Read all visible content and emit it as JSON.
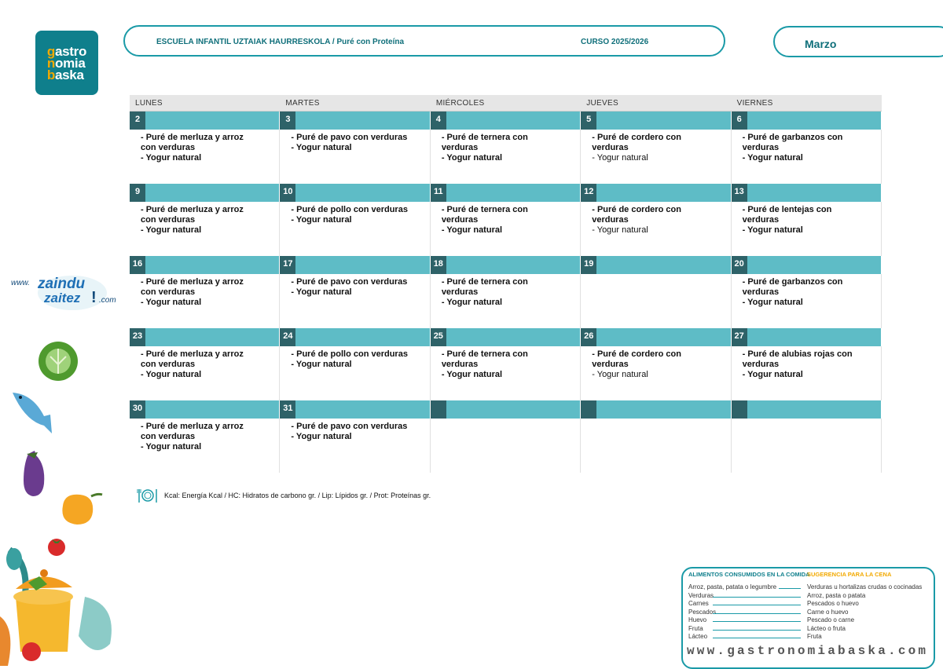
{
  "logo": {
    "line1": "gastro",
    "line2": "nomia",
    "line3": "baska",
    "first_letters": [
      "g",
      "n",
      "b"
    ]
  },
  "header": {
    "title": "ESCUELA INFANTIL UZTAIAK HAURRESKOLA / Puré con Proteína",
    "course": "CURSO 2025/2026"
  },
  "month": "Marzo",
  "calendar": {
    "day_names": [
      "LUNES",
      "MARTES",
      "MIÉRCOLES",
      "JUEVES",
      "VIERNES"
    ],
    "weeks": [
      {
        "days": [
          {
            "num": "2",
            "lines": [
              "- Puré de merluza y arroz",
              "con verduras",
              "- Yogur natural"
            ],
            "normal": []
          },
          {
            "num": "3",
            "lines": [
              "- Puré de pavo con verduras",
              "- Yogur natural"
            ],
            "normal": []
          },
          {
            "num": "4",
            "lines": [
              "- Puré de ternera con",
              "verduras",
              "- Yogur natural"
            ],
            "normal": []
          },
          {
            "num": "5",
            "lines": [
              "- Puré de cordero con",
              "verduras",
              "- Yogur natural"
            ],
            "normal": [
              2
            ]
          },
          {
            "num": "6",
            "lines": [
              "- Puré de garbanzos con",
              "verduras",
              "- Yogur natural"
            ],
            "normal": []
          }
        ]
      },
      {
        "days": [
          {
            "num": "9",
            "lines": [
              "- Puré de merluza y arroz",
              "con verduras",
              "- Yogur natural"
            ],
            "normal": []
          },
          {
            "num": "10",
            "lines": [
              "- Puré de pollo con verduras",
              "- Yogur natural"
            ],
            "normal": []
          },
          {
            "num": "11",
            "lines": [
              "- Puré de ternera con",
              "verduras",
              "- Yogur natural"
            ],
            "normal": []
          },
          {
            "num": "12",
            "lines": [
              "- Puré de cordero con",
              "verduras",
              "- Yogur natural"
            ],
            "normal": [
              2
            ]
          },
          {
            "num": "13",
            "lines": [
              "- Puré de lentejas con",
              "verduras",
              "- Yogur natural"
            ],
            "normal": []
          }
        ]
      },
      {
        "days": [
          {
            "num": "16",
            "lines": [
              "- Puré de merluza y arroz",
              "con verduras",
              "- Yogur natural"
            ],
            "normal": []
          },
          {
            "num": "17",
            "lines": [
              "- Puré de pavo con verduras",
              "- Yogur natural"
            ],
            "normal": []
          },
          {
            "num": "18",
            "lines": [
              "- Puré de ternera con",
              "verduras",
              "- Yogur natural"
            ],
            "normal": []
          },
          {
            "num": "19",
            "lines": [],
            "normal": []
          },
          {
            "num": "20",
            "lines": [
              "- Puré de garbanzos con",
              "verduras",
              "- Yogur natural"
            ],
            "normal": []
          }
        ]
      },
      {
        "days": [
          {
            "num": "23",
            "lines": [
              "- Puré de merluza y arroz",
              "con verduras",
              "- Yogur natural"
            ],
            "normal": []
          },
          {
            "num": "24",
            "lines": [
              "- Puré de pollo con verduras",
              "- Yogur natural"
            ],
            "normal": []
          },
          {
            "num": "25",
            "lines": [
              "- Puré de ternera con",
              "verduras",
              "- Yogur natural"
            ],
            "normal": []
          },
          {
            "num": "26",
            "lines": [
              "- Puré de cordero con",
              "verduras",
              "- Yogur natural"
            ],
            "normal": [
              2
            ]
          },
          {
            "num": "27",
            "lines": [
              "- Puré de alubias rojas con",
              "verduras",
              "- Yogur natural"
            ],
            "normal": []
          }
        ]
      },
      {
        "days": [
          {
            "num": "30",
            "lines": [
              "- Puré de merluza y arroz",
              "con verduras",
              "- Yogur natural"
            ],
            "normal": []
          },
          {
            "num": "31",
            "lines": [
              "- Puré de pavo con verduras",
              "- Yogur natural"
            ],
            "normal": []
          },
          {
            "num": "",
            "lines": [],
            "normal": []
          },
          {
            "num": "",
            "lines": [],
            "normal": []
          },
          {
            "num": "",
            "lines": [],
            "normal": []
          }
        ]
      }
    ]
  },
  "legend": "Kcal: Energía Kcal / HC: Hidratos de carbono gr. / Lip: Lípidos gr. / Prot: Proteínas gr.",
  "side_ad": {
    "prefix": "www.",
    "word1": "zaindu",
    "word2": "zaitez",
    "mark": "!",
    "suffix": ".com"
  },
  "suggestion": {
    "left_title": "ALIMENTOS CONSUMIDOS EN LA COMIDA",
    "right_title": "SUGERENCIA PARA LA CENA",
    "rows": [
      {
        "left": "Arroz, pasta, patata o legumbre",
        "right": "Verduras u hortalizas crudas o cocinadas"
      },
      {
        "left": "Verduras",
        "right": "Arroz, pasta o patata"
      },
      {
        "left": "Carnes",
        "right": "Pescados o huevo"
      },
      {
        "left": "Pescados",
        "right": "Carne o huevo"
      },
      {
        "left": "Huevo",
        "right": "Pescado o carne"
      },
      {
        "left": "Fruta",
        "right": "Lácteo o fruta"
      },
      {
        "left": "Lácteo",
        "right": "Fruta"
      }
    ],
    "website": "www.gastronomiabaska.com"
  },
  "colors": {
    "teal_dark": "#2e6268",
    "teal_light": "#5ebcc6",
    "border_teal": "#1a9aa7",
    "orange": "#f2a900"
  }
}
